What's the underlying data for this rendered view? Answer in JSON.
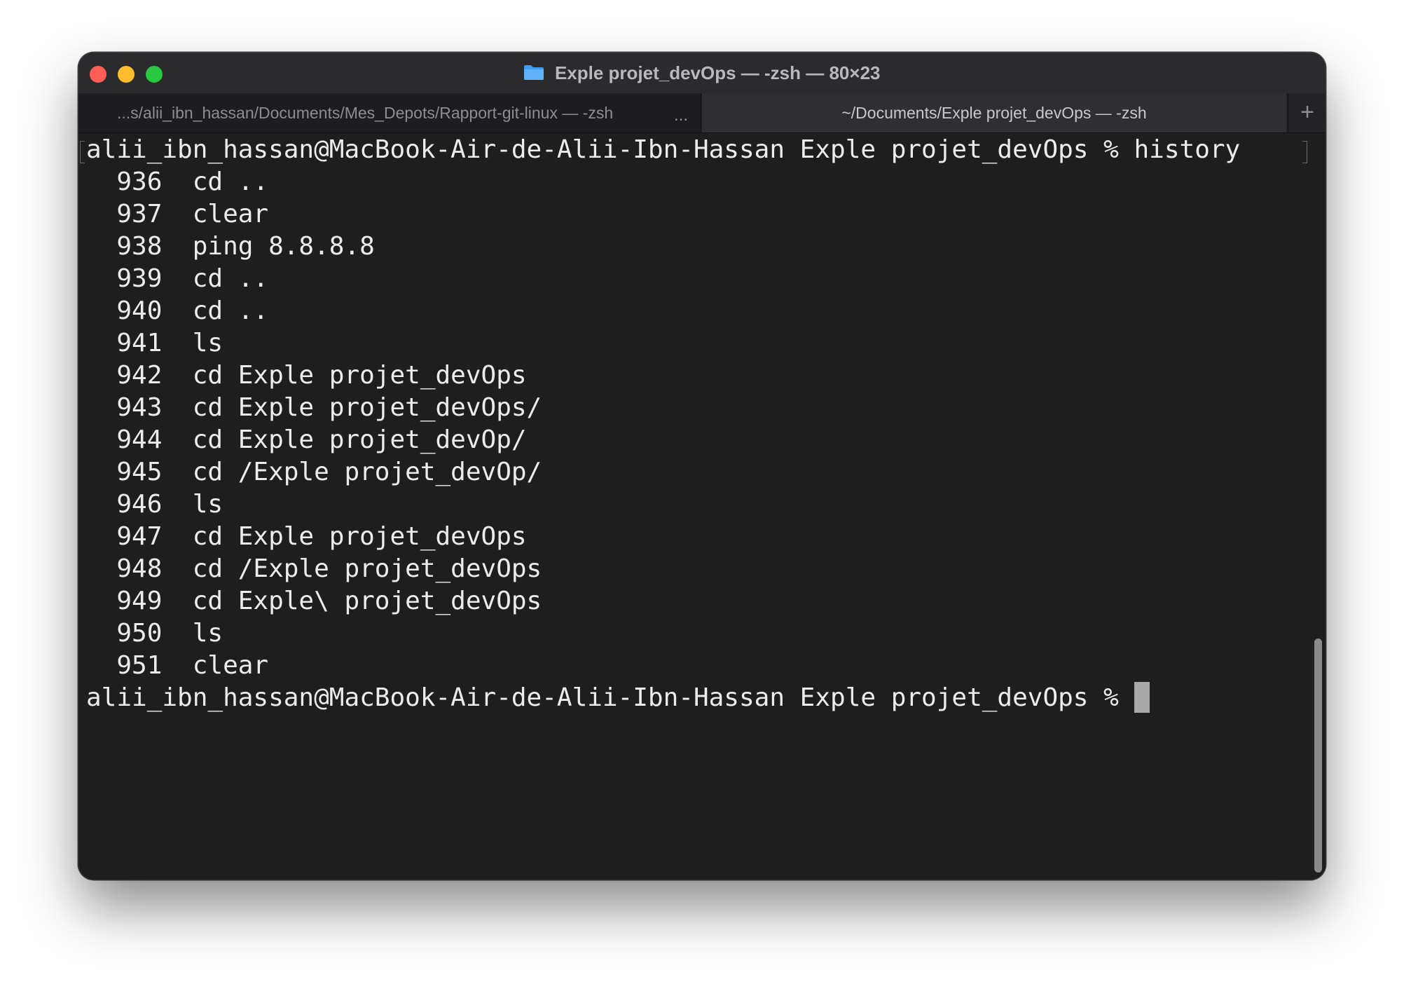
{
  "window": {
    "title": "Exple projet_devOps — -zsh — 80×23",
    "title_icon": "folder-icon",
    "traffic_lights": {
      "close_color": "#ff5f57",
      "minimize_color": "#febc2e",
      "maximize_color": "#28c840"
    }
  },
  "tabs": [
    {
      "label": "...s/alii_ibn_hassan/Documents/Mes_Depots/Rapport-git-linux — -zsh",
      "active": false,
      "more": "..."
    },
    {
      "label": "~/Documents/Exple projet_devOps — -zsh",
      "active": true
    }
  ],
  "new_tab_label": "+",
  "terminal": {
    "lines": [
      "alii_ibn_hassan@MacBook-Air-de-Alii-Ibn-Hassan Exple projet_devOps % history",
      "  936  cd ..",
      "  937  clear",
      "  938  ping 8.8.8.8",
      "  939  cd ..",
      "  940  cd ..",
      "  941  ls",
      "  942  cd Exple projet_devOps",
      "  943  cd Exple projet_devOps/",
      "  944  cd Exple projet_devOp/",
      "  945  cd /Exple projet_devOp/",
      "  946  ls",
      "  947  cd Exple projet_devOps",
      "  948  cd /Exple projet_devOps",
      "  949  cd Exple\\ projet_devOps",
      "  950  ls",
      "  951  clear"
    ],
    "prompt": "alii_ibn_hassan@MacBook-Air-de-Alii-Ibn-Hassan Exple projet_devOps % "
  },
  "colors": {
    "terminal_background": "#1e1e1e",
    "terminal_text": "#ececec",
    "cursor": "#a9a9a9"
  }
}
